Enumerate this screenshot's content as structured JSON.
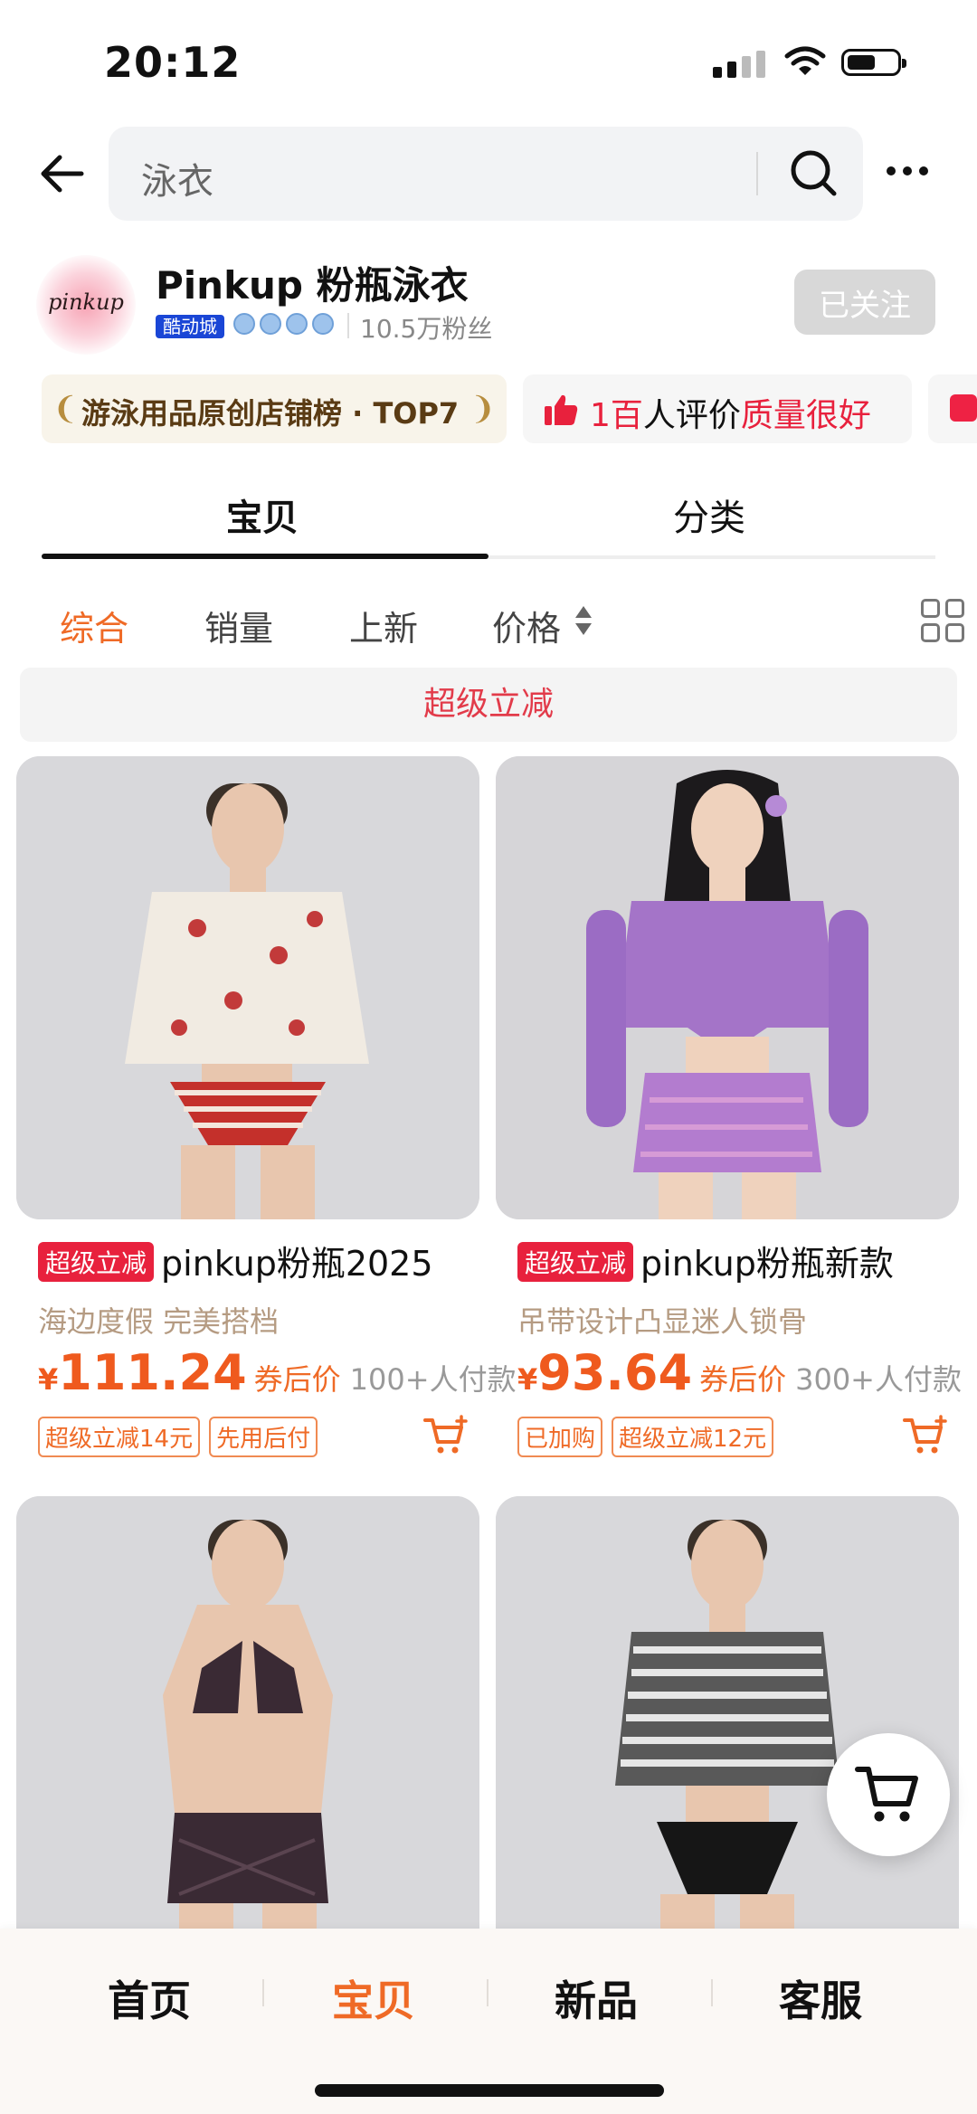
{
  "status_bar": {
    "time": "20:12"
  },
  "search": {
    "placeholder": "泳衣"
  },
  "shop": {
    "logo_text": "pinkup",
    "name": "Pinkup 粉瓶泳衣",
    "badge": "酷动城",
    "fans": "10.5万粉丝",
    "follow_label": "已关注"
  },
  "tags": {
    "rank": "游泳用品原创店铺榜 · TOP7",
    "review_count": "1百",
    "review_mid": "人评价",
    "review_quality": "质量很好"
  },
  "tabs": [
    {
      "label": "宝贝",
      "active": true
    },
    {
      "label": "分类",
      "active": false
    }
  ],
  "sort": {
    "comprehensive": "综合",
    "sales": "销量",
    "new": "上新",
    "price": "价格"
  },
  "banner": {
    "label": "超级立减"
  },
  "products": [
    {
      "tag": "超级立减",
      "title": "pinkup粉瓶2025",
      "subtitle": "海边度假 完美搭档",
      "currency": "¥",
      "price": "111.24",
      "price_note": "券后价",
      "sold": "100+人付款",
      "chips": [
        "超级立减14元",
        "先用后付"
      ]
    },
    {
      "tag": "超级立减",
      "title": "pinkup粉瓶新款",
      "subtitle": "吊带设计凸显迷人锁骨",
      "currency": "¥",
      "price": "93.64",
      "price_note": "券后价",
      "sold": "300+人付款",
      "chips": [
        "已加购",
        "超级立减12元"
      ]
    }
  ],
  "bottom_nav": [
    {
      "label": "首页",
      "active": false
    },
    {
      "label": "宝贝",
      "active": true
    },
    {
      "label": "新品",
      "active": false
    },
    {
      "label": "客服",
      "active": false
    }
  ],
  "colors": {
    "accent": "#ef6a26",
    "red": "#e8213d",
    "banner_text": "#e23b4a"
  }
}
